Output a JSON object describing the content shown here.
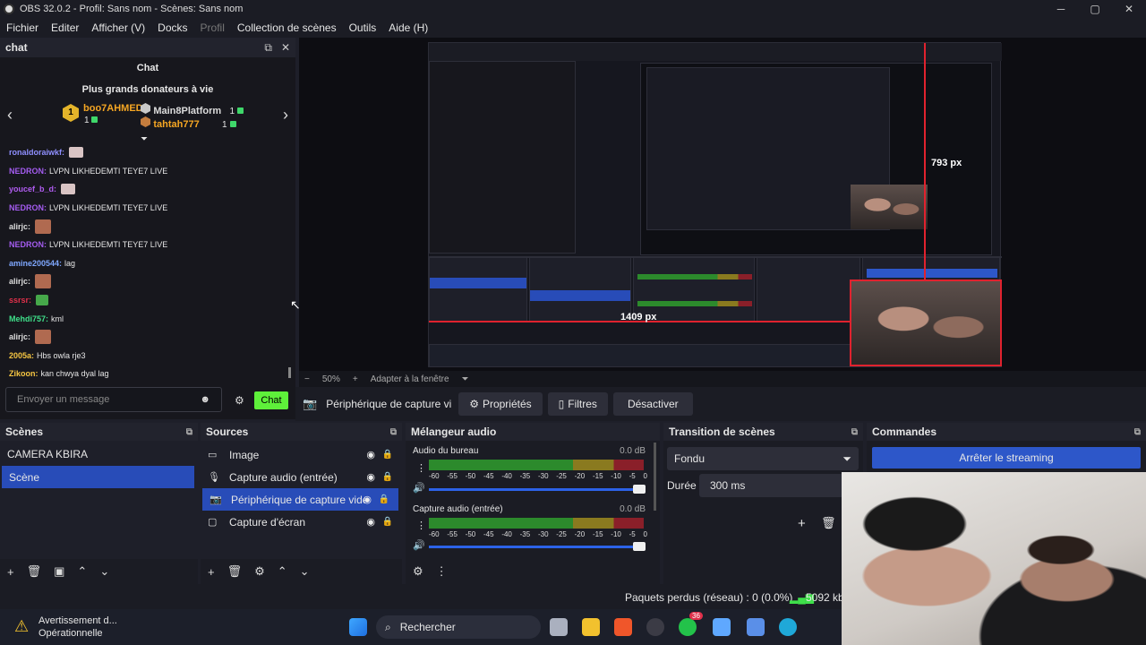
{
  "window": {
    "title": "OBS 32.0.2 - Profil: Sans nom - Scènes: Sans nom",
    "controls": [
      "─",
      "▢",
      "✕"
    ]
  },
  "menu": [
    "Fichier",
    "Editer",
    "Afficher (V)",
    "Docks",
    "Profil",
    "Collection de scènes",
    "Outils",
    "Aide (H)"
  ],
  "chat": {
    "dock_title": "chat",
    "panel_title": "Chat",
    "donors_title": "Plus grands donateurs à vie",
    "top_donor": {
      "name": "boo7AHMED",
      "amount": "1",
      "rank": "1"
    },
    "donor2": {
      "name": "Main8Platform",
      "amount": "1"
    },
    "donor3": {
      "name": "tahtah777",
      "amount": "1"
    },
    "messages": [
      {
        "user": "ronaldoraiwkf:",
        "text": "",
        "color": "#8f8fff",
        "emote": "w"
      },
      {
        "user": "NEDRON:",
        "text": "LVPN LIKHEDEMTI TEYE7 LIVE",
        "color": "#a45cf0"
      },
      {
        "user": "youcef_b_d:",
        "text": "",
        "color": "#b05cf0",
        "emote": "w"
      },
      {
        "user": "NEDRON:",
        "text": "LVPN LIKHEDEMTI TEYE7 LIVE",
        "color": "#a45cf0"
      },
      {
        "user": "alirjc:",
        "text": "",
        "color": "#dddddd",
        "emote": "r"
      },
      {
        "user": "NEDRON:",
        "text": "LVPN LIKHEDEMTI TEYE7 LIVE",
        "color": "#a45cf0"
      },
      {
        "user": "amine200544:",
        "text": "lag",
        "color": "#7fa8ff"
      },
      {
        "user": "alirjc:",
        "text": "",
        "color": "#dddddd",
        "emote": "r"
      },
      {
        "user": "ssrsr:",
        "text": "",
        "color": "#e0304a",
        "emote": "g"
      },
      {
        "user": "Mehdi757:",
        "text": "kml",
        "color": "#3fe08a"
      },
      {
        "user": "alirjc:",
        "text": "",
        "color": "#dddddd",
        "emote": "r"
      },
      {
        "user": "2005a:",
        "text": "Hbs owla rje3",
        "color": "#f5c542"
      },
      {
        "user": "Zikoon:",
        "text": "kan chwya dyal lag",
        "color": "#f5c542"
      }
    ],
    "input_placeholder": "Envoyer un message",
    "send_label": "Chat"
  },
  "preview": {
    "measure_right": "793 px",
    "measure_bottom": "1409 px",
    "zoom": "50%",
    "fit_mode": "Adapter à la fenêtre"
  },
  "source_toolbar": {
    "source_name": "Périphérique de capture vi",
    "properties": "Propriétés",
    "filters": "Filtres",
    "deactivate": "Désactiver"
  },
  "scenes": {
    "title": "Scènes",
    "items": [
      "CAMERA KBIRA",
      "Scène"
    ],
    "selected": 1
  },
  "sources": {
    "title": "Sources",
    "items": [
      {
        "name": "Image",
        "icon": "image-icon"
      },
      {
        "name": "Capture audio (entrée)",
        "icon": "mic-icon"
      },
      {
        "name": "Périphérique de capture vidéo",
        "icon": "camera-icon"
      },
      {
        "name": "Capture d'écran",
        "icon": "monitor-icon"
      }
    ],
    "selected": 2
  },
  "mixer": {
    "title": "Mélangeur audio",
    "channels": [
      {
        "name": "Audio du bureau",
        "db": "0.0 dB",
        "level": 1.0
      },
      {
        "name": "Capture audio (entrée)",
        "db": "0.0 dB",
        "level": 1.0
      }
    ],
    "ticks": [
      "-60",
      "-55",
      "-50",
      "-45",
      "-40",
      "-35",
      "-30",
      "-25",
      "-20",
      "-15",
      "-10",
      "-5",
      "0"
    ]
  },
  "transition": {
    "title": "Transition de scènes",
    "type": "Fondu",
    "duration_label": "Durée",
    "duration_value": "300 ms"
  },
  "controls": {
    "title": "Commandes",
    "stop_stream": "Arrêter le streaming"
  },
  "status": {
    "dropped": "Paquets perdus (réseau) : 0 (0.0%)",
    "bitrate": "5092 kb"
  },
  "taskbar": {
    "notif_title": "Avertissement d...",
    "notif_sub": "Opérationnelle",
    "search": "Rechercher",
    "badge": "36"
  },
  "colors": {
    "accent": "#284cb8",
    "stream_btn": "#2d57c9",
    "chat_btn": "#5ef03a",
    "red_guide": "#e0222e"
  }
}
